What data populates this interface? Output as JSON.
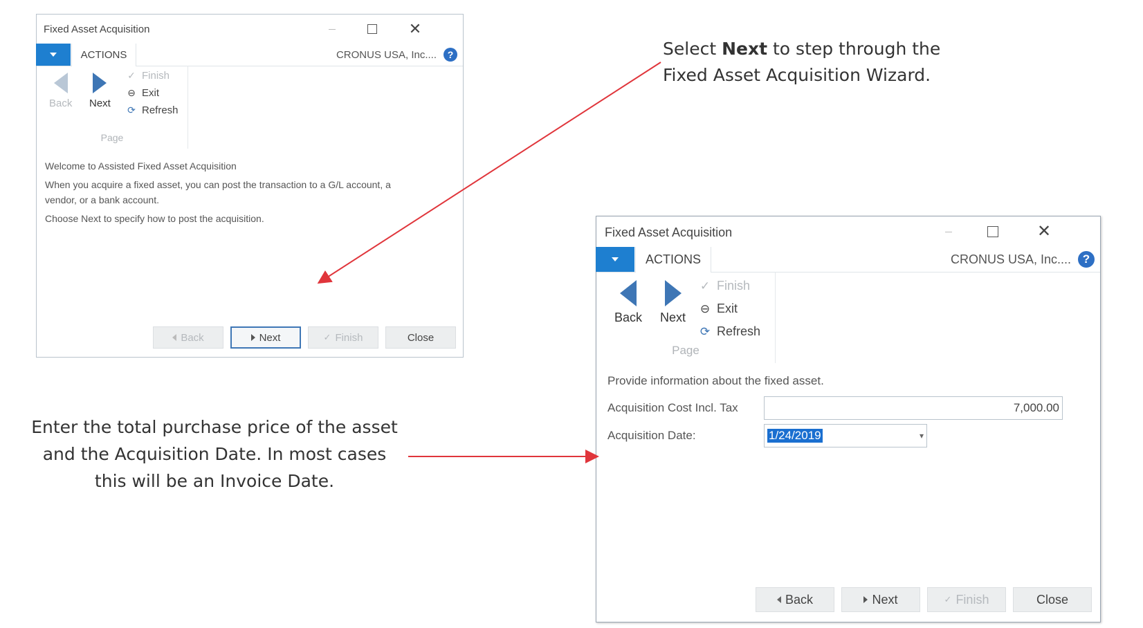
{
  "window1": {
    "title": "Fixed Asset Acquisition",
    "tab_actions": "ACTIONS",
    "company": "CRONUS USA, Inc....",
    "help": "?",
    "ribbon": {
      "back": "Back",
      "next": "Next",
      "finish": "Finish",
      "exit": "Exit",
      "refresh": "Refresh",
      "group_label": "Page"
    },
    "content": {
      "heading": "Welcome to Assisted Fixed Asset Acquisition",
      "body": "When you acquire a fixed asset, you can post the transaction to a G/L account, a vendor, or a bank account.",
      "instruction": "Choose Next to specify how to post the acquisition."
    },
    "footer": {
      "back": "Back",
      "next": "Next",
      "finish": "Finish",
      "close": "Close"
    }
  },
  "window2": {
    "title": "Fixed Asset Acquisition",
    "tab_actions": "ACTIONS",
    "company": "CRONUS USA, Inc....",
    "help": "?",
    "ribbon": {
      "back": "Back",
      "next": "Next",
      "finish": "Finish",
      "exit": "Exit",
      "refresh": "Refresh",
      "group_label": "Page"
    },
    "content": {
      "info": "Provide information about the fixed asset.",
      "cost_label": "Acquisition Cost Incl. Tax",
      "cost_value": "7,000.00",
      "date_label": "Acquisition Date:",
      "date_value": "1/24/2019"
    },
    "footer": {
      "back": "Back",
      "next": "Next",
      "finish": "Finish",
      "close": "Close"
    }
  },
  "callouts": {
    "callout1_pre": "Select ",
    "callout1_bold": "Next",
    "callout1_post": " to step through the Fixed Asset Acquisition Wizard.",
    "callout2": "Enter the total purchase price of the asset and the Acquisition Date.  In most cases this will be an Invoice Date."
  },
  "colors": {
    "accent_blue": "#1e7fd0",
    "arrow_red": "#e0353b",
    "selection_blue": "#1a6fd0"
  }
}
